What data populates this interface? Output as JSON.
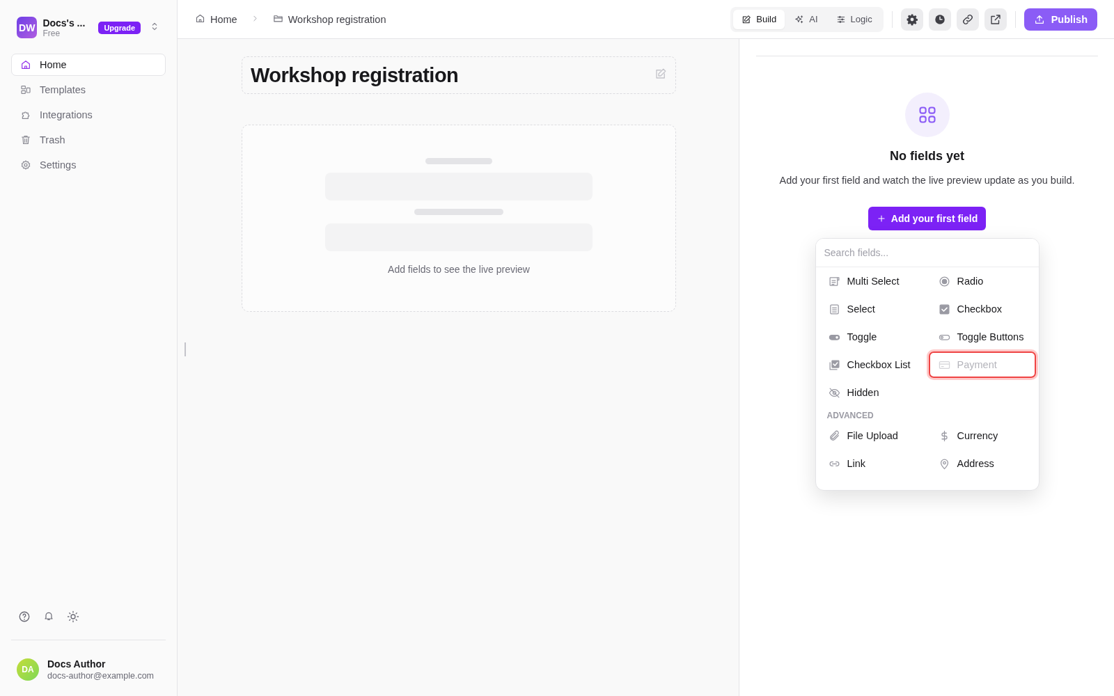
{
  "workspace": {
    "initials": "DW",
    "name": "Docs's ...",
    "plan": "Free",
    "upgrade": "Upgrade"
  },
  "nav": [
    {
      "label": "Home",
      "kind": "home",
      "selected": true
    },
    {
      "label": "Templates",
      "kind": "templates",
      "selected": false
    },
    {
      "label": "Integrations",
      "kind": "integrations",
      "selected": false
    },
    {
      "label": "Trash",
      "kind": "trash",
      "selected": false
    },
    {
      "label": "Settings",
      "kind": "settings",
      "selected": false
    }
  ],
  "user": {
    "initials": "DA",
    "name": "Docs Author",
    "email": "docs-author@example.com"
  },
  "breadcrumb": [
    {
      "label": "Home",
      "kind": "home"
    },
    {
      "label": "Workshop registration",
      "kind": "folder"
    }
  ],
  "modes": [
    {
      "label": "Build",
      "kind": "build",
      "selected": true
    },
    {
      "label": "AI",
      "kind": "ai",
      "selected": false
    },
    {
      "label": "Logic",
      "kind": "logic",
      "selected": false
    }
  ],
  "publish": "Publish",
  "form": {
    "title": "Workshop registration",
    "preview_hint": "Add fields to see the live preview"
  },
  "panel": {
    "empty_title": "No fields yet",
    "empty_text": "Add your first field and watch the live preview update as you build.",
    "add_button": "Add your first field"
  },
  "field_menu": {
    "search_placeholder": "Search fields...",
    "sections": [
      {
        "items": [
          {
            "label": "Multi Select",
            "kind": "multi_select",
            "disabled": false,
            "selected": false
          },
          {
            "label": "Radio",
            "kind": "radio",
            "disabled": false,
            "selected": false
          },
          {
            "label": "Select",
            "kind": "select",
            "disabled": false,
            "selected": false
          },
          {
            "label": "Checkbox",
            "kind": "checkbox",
            "disabled": false,
            "selected": false
          },
          {
            "label": "Toggle",
            "kind": "toggle",
            "disabled": false,
            "selected": false
          },
          {
            "label": "Toggle Buttons",
            "kind": "toggle_buttons",
            "disabled": false,
            "selected": false
          },
          {
            "label": "Checkbox List",
            "kind": "checkbox_list",
            "disabled": false,
            "selected": false
          },
          {
            "label": "Payment",
            "kind": "payment",
            "disabled": true,
            "selected": true
          },
          {
            "label": "Hidden",
            "kind": "hidden",
            "disabled": false,
            "selected": false
          }
        ]
      },
      {
        "title": "ADVANCED",
        "items": [
          {
            "label": "File Upload",
            "kind": "file_upload",
            "disabled": false,
            "selected": false
          },
          {
            "label": "Currency",
            "kind": "currency",
            "disabled": false,
            "selected": false
          },
          {
            "label": "Link",
            "kind": "link",
            "disabled": false,
            "selected": false
          },
          {
            "label": "Address",
            "kind": "address",
            "disabled": false,
            "selected": false
          }
        ]
      }
    ]
  }
}
